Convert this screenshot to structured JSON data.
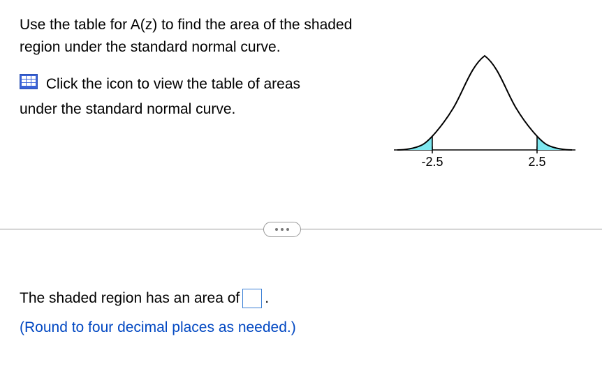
{
  "question": {
    "line1": "Use the table for A(z) to find the area of the shaded region under the standard normal curve.",
    "click_text_1": "Click the icon to view the table of areas",
    "click_text_2": "under the standard normal curve."
  },
  "chart_data": {
    "type": "area",
    "title": "",
    "xlabel": "",
    "ylabel": "",
    "x_ticks": [
      "-2.5",
      "2.5"
    ],
    "shaded_regions": [
      {
        "from": -3.5,
        "to": -2.5
      },
      {
        "from": 2.5,
        "to": 3.5
      }
    ],
    "curve": "standard_normal_pdf"
  },
  "answer": {
    "prefix": "The shaded region has an area of",
    "suffix": ".",
    "hint": "(Round to four decimal places as needed.)"
  },
  "graph_labels": {
    "left_tick": "-2.5",
    "right_tick": "2.5"
  }
}
